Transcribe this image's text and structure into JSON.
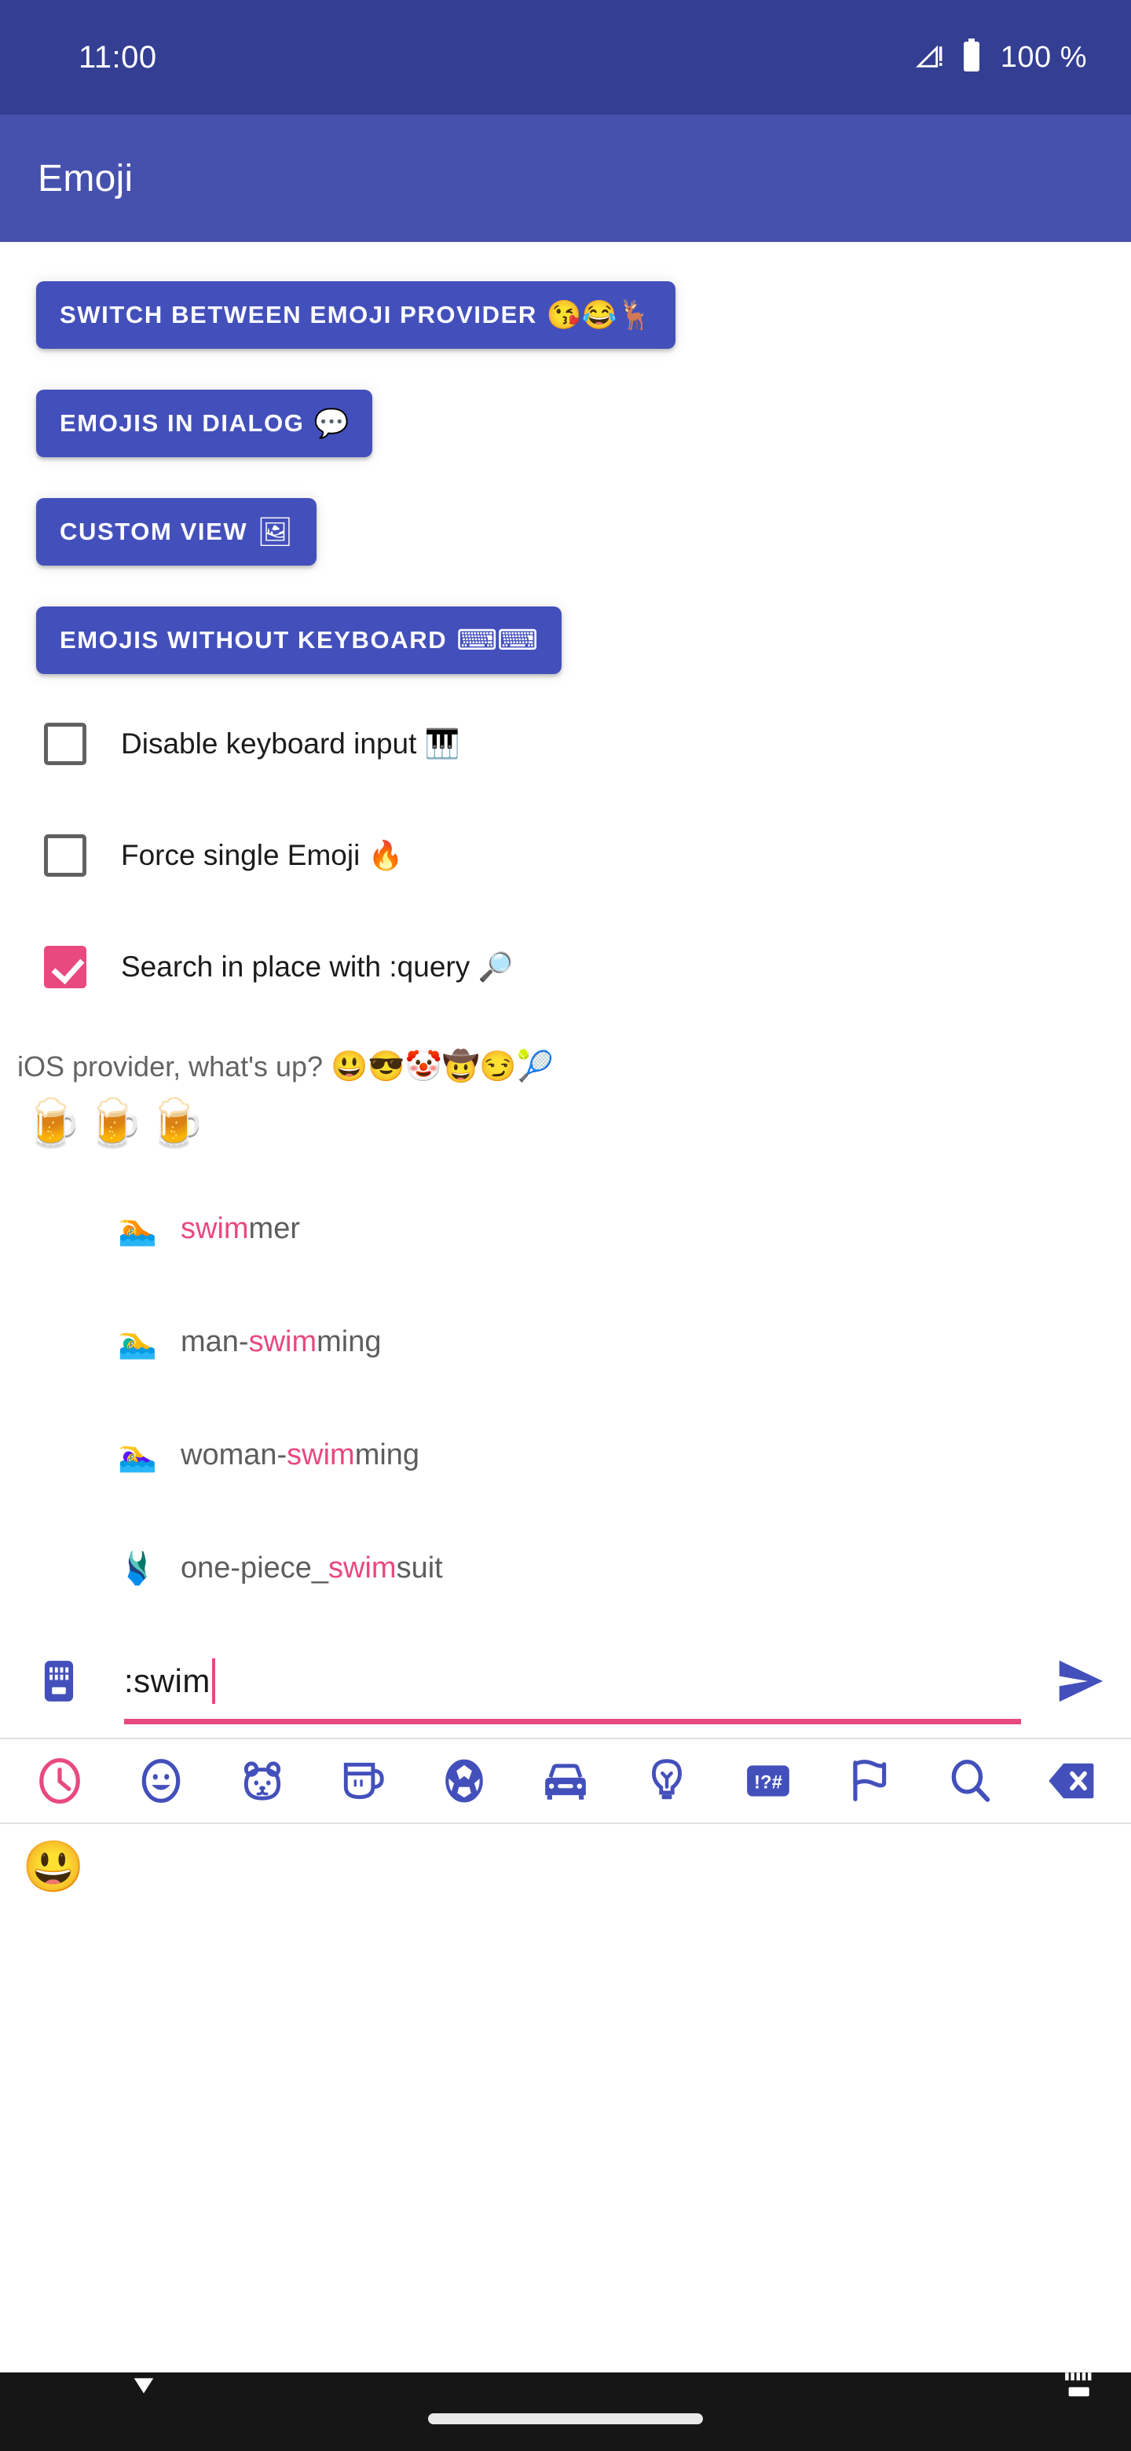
{
  "status_bar": {
    "time": "11:00",
    "battery_text": "100 %",
    "signal_icon": "signal-no-sim-icon",
    "battery_icon": "battery-full-icon",
    "background_color": "#343e93"
  },
  "app_bar": {
    "title": "Emoji",
    "background_color": "#4650ad"
  },
  "theme": {
    "button_blue": "#4350bb",
    "accent_pink": "#e8497f",
    "icon_blue": "#4350bb",
    "text_gray": "#5d5d5d"
  },
  "buttons": [
    {
      "label": "SWITCH BETWEEN EMOJI PROVIDER",
      "emoji": "😘😂🦌"
    },
    {
      "label": "EMOJIS IN DIALOG",
      "emoji": "💬"
    },
    {
      "label": "CUSTOM VIEW",
      "emoji": "🖼"
    },
    {
      "label": "EMOJIS WITHOUT KEYBOARD",
      "emoji": "⌨⌨"
    }
  ],
  "checkboxes": [
    {
      "label": "Disable keyboard input ",
      "emoji": "🎹",
      "checked": false
    },
    {
      "label": "Force single Emoji ",
      "emoji": "🔥",
      "checked": false
    },
    {
      "label": "Search in place with :query ",
      "emoji": "🔎",
      "checked": true
    }
  ],
  "provider_hint": {
    "text": "iOS provider, what's up? ",
    "emoji": "😃😎🤡🤠😏🎾"
  },
  "typed_emojis": "🍺🍺🍺",
  "suggestions": [
    {
      "emoji": "🏊",
      "prefix": "",
      "match": "swim",
      "suffix": "mer"
    },
    {
      "emoji": "🏊‍♂️",
      "prefix": "man-",
      "match": "swim",
      "suffix": "ming"
    },
    {
      "emoji": "🏊‍♀️",
      "prefix": "woman-",
      "match": "swim",
      "suffix": "ming"
    },
    {
      "emoji": "🩱",
      "prefix": "one-piece_",
      "match": "swim",
      "suffix": "suit"
    }
  ],
  "input": {
    "value": ":swim",
    "placeholder": "",
    "keyboard_icon": "keyboard-icon",
    "send_icon": "send-icon"
  },
  "categories": [
    {
      "name": "recent",
      "icon": "clock-icon",
      "active": true
    },
    {
      "name": "smileys",
      "icon": "smiley-icon",
      "active": false
    },
    {
      "name": "animals",
      "icon": "animal-face-icon",
      "active": false
    },
    {
      "name": "food",
      "icon": "coffee-cup-icon",
      "active": false
    },
    {
      "name": "sports",
      "icon": "soccer-ball-icon",
      "active": false
    },
    {
      "name": "travel",
      "icon": "car-icon",
      "active": false
    },
    {
      "name": "objects",
      "icon": "lightbulb-icon",
      "active": false
    },
    {
      "name": "symbols",
      "icon": "symbols-icon",
      "active": false
    },
    {
      "name": "flags",
      "icon": "flag-icon",
      "active": false
    },
    {
      "name": "search",
      "icon": "search-icon",
      "active": false
    },
    {
      "name": "backspace",
      "icon": "backspace-icon",
      "active": false
    }
  ],
  "emoji_grid": [
    "😃"
  ],
  "nav_bar": {
    "hide_keyboard_icon": "chevron-down-icon",
    "home_pill": "home-gesture-pill",
    "switch_keyboard_icon": "keyboard-switch-icon",
    "background_color": "#161616"
  }
}
